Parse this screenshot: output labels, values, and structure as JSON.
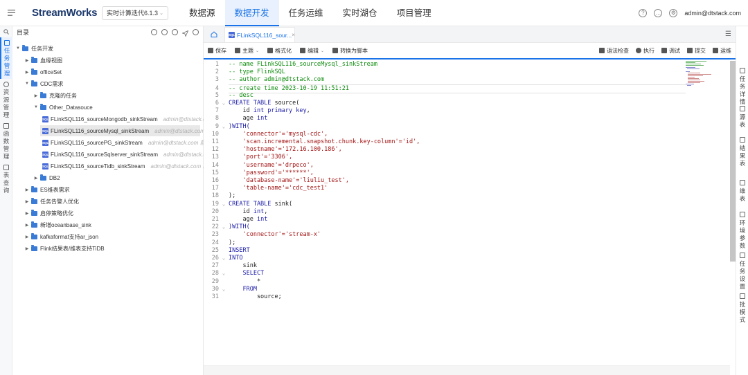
{
  "header": {
    "logo_text": "StreamWorks",
    "project_select": "实时计算迭代6.1.3",
    "nav": [
      "数据源",
      "数据开发",
      "任务运维",
      "实时湖仓",
      "项目管理"
    ],
    "active_nav": "数据开发",
    "user": "admin@dtstack.com"
  },
  "leftnav": {
    "items": [
      {
        "label": "任务管理",
        "active": true
      },
      {
        "label": "资源管理",
        "active": false
      },
      {
        "label": "函数管理",
        "active": false
      },
      {
        "label": "表查询",
        "active": false
      }
    ]
  },
  "tree": {
    "title": "目录",
    "nodes": [
      {
        "label": "任务开发",
        "type": "folder",
        "depth": 0,
        "expanded": true
      },
      {
        "label": "血缘视图",
        "type": "folder",
        "depth": 1,
        "expanded": false
      },
      {
        "label": "officeSet",
        "type": "folder",
        "depth": 1,
        "expanded": false
      },
      {
        "label": "CDC需求",
        "type": "folder",
        "depth": 1,
        "expanded": true
      },
      {
        "label": "克隆的任务",
        "type": "folder",
        "depth": 2,
        "expanded": false
      },
      {
        "label": "Other_Datasouce",
        "type": "folder",
        "depth": 2,
        "expanded": true
      },
      {
        "label": "FLinkSQL116_sourceMongodb_sinkStream",
        "type": "sql",
        "depth": 3,
        "owner": "admin@dtstack.c..."
      },
      {
        "label": "FLinkSQL116_sourceMysql_sinkStream",
        "type": "sql",
        "depth": 3,
        "owner": "admin@dtstack.com",
        "selected": true
      },
      {
        "label": "FLinkSQL116_sourcePG_sinkStream",
        "type": "sql",
        "depth": 3,
        "owner": "admin@dtstack.com 就..."
      },
      {
        "label": "FLinkSQL116_sourceSqlserver_sinkStream",
        "type": "sql",
        "depth": 3,
        "owner": "admin@dtstack.c..."
      },
      {
        "label": "FLinkSQL116_sourceTidb_sinkStream",
        "type": "sql",
        "depth": 3,
        "owner": "admin@dtstack.com 就..."
      },
      {
        "label": "DB2",
        "type": "folder",
        "depth": 2,
        "expanded": false
      },
      {
        "label": "ES维表需求",
        "type": "folder",
        "depth": 1,
        "expanded": false
      },
      {
        "label": "任务告警人优化",
        "type": "folder",
        "depth": 1,
        "expanded": false
      },
      {
        "label": "启停策略优化",
        "type": "folder",
        "depth": 1,
        "expanded": false
      },
      {
        "label": "新增oceanbase_sink",
        "type": "folder",
        "depth": 1,
        "expanded": false
      },
      {
        "label": "kafkaformat支持ar_json",
        "type": "folder",
        "depth": 1,
        "expanded": false
      },
      {
        "label": "Flink结果表/维表支持TiDB",
        "type": "folder",
        "depth": 1,
        "expanded": false
      }
    ]
  },
  "editor": {
    "tab_label": "FLinkSQL116_sour...",
    "toolbar_left": [
      {
        "label": "保存",
        "dropdown": false
      },
      {
        "label": "主题",
        "dropdown": true
      },
      {
        "label": "格式化",
        "dropdown": false
      },
      {
        "label": "编辑",
        "dropdown": true
      },
      {
        "label": "转换为脚本",
        "dropdown": false
      }
    ],
    "toolbar_right": [
      "语法检查",
      "执行",
      "调试",
      "提交",
      "运维"
    ],
    "code_lines": [
      {
        "n": "1",
        "fold": "",
        "parts": [
          {
            "t": "-- name FLinkSQL116_sourceMysql_sinkStream",
            "c": "com"
          }
        ]
      },
      {
        "n": "2",
        "fold": "",
        "parts": [
          {
            "t": "-- type FlinkSQL",
            "c": "com"
          }
        ]
      },
      {
        "n": "3",
        "fold": "",
        "parts": [
          {
            "t": "-- author admin@dtstack.com",
            "c": "com"
          }
        ]
      },
      {
        "n": "4",
        "fold": "",
        "hl": true,
        "parts": [
          {
            "t": "-- create time 2023-10-19 11:51:21",
            "c": "com"
          }
        ]
      },
      {
        "n": "5",
        "fold": "",
        "parts": [
          {
            "t": "-- desc",
            "c": "com"
          }
        ]
      },
      {
        "n": "6",
        "fold": "v",
        "parts": [
          {
            "t": "CREATE TABLE ",
            "c": "kw"
          },
          {
            "t": "source(",
            "c": "id"
          }
        ]
      },
      {
        "n": "7",
        "fold": "",
        "parts": [
          {
            "t": "    id ",
            "c": "id"
          },
          {
            "t": "int primary key",
            "c": "kw"
          },
          {
            "t": ",",
            "c": "id"
          }
        ]
      },
      {
        "n": "8",
        "fold": "",
        "parts": [
          {
            "t": "    age ",
            "c": "id"
          },
          {
            "t": "int",
            "c": "kw"
          }
        ]
      },
      {
        "n": "9",
        "fold": "v",
        "parts": [
          {
            "t": ")WITH(",
            "c": "kw"
          }
        ]
      },
      {
        "n": "10",
        "fold": "",
        "parts": [
          {
            "t": "    'connector'='mysql-cdc',",
            "c": "str"
          }
        ]
      },
      {
        "n": "11",
        "fold": "",
        "parts": [
          {
            "t": "    'scan.incremental.snapshot.chunk.key-column'='id',",
            "c": "str"
          }
        ]
      },
      {
        "n": "12",
        "fold": "",
        "parts": [
          {
            "t": "    'hostname'='172.16.100.186',",
            "c": "str"
          }
        ]
      },
      {
        "n": "13",
        "fold": "",
        "parts": [
          {
            "t": "    'port'='3306',",
            "c": "str"
          }
        ]
      },
      {
        "n": "14",
        "fold": "",
        "parts": [
          {
            "t": "    'username'='drpeco',",
            "c": "str"
          }
        ]
      },
      {
        "n": "15",
        "fold": "",
        "parts": [
          {
            "t": "    'password'='******',",
            "c": "str"
          }
        ]
      },
      {
        "n": "16",
        "fold": "",
        "parts": [
          {
            "t": "    'database-name'='liuliu_test',",
            "c": "str"
          }
        ]
      },
      {
        "n": "17",
        "fold": "",
        "parts": [
          {
            "t": "    'table-name'='cdc_test1'",
            "c": "str"
          }
        ]
      },
      {
        "n": "18",
        "fold": "",
        "parts": [
          {
            "t": ");",
            "c": "id"
          }
        ]
      },
      {
        "n": "19",
        "fold": "v",
        "parts": [
          {
            "t": "CREATE TABLE ",
            "c": "kw"
          },
          {
            "t": "sink(",
            "c": "id"
          }
        ]
      },
      {
        "n": "20",
        "fold": "",
        "parts": [
          {
            "t": "    id ",
            "c": "id"
          },
          {
            "t": "int",
            "c": "kw"
          },
          {
            "t": ",",
            "c": "id"
          }
        ]
      },
      {
        "n": "21",
        "fold": "",
        "parts": [
          {
            "t": "    age ",
            "c": "id"
          },
          {
            "t": "int",
            "c": "kw"
          }
        ]
      },
      {
        "n": "22",
        "fold": "v",
        "parts": [
          {
            "t": ")WITH(",
            "c": "kw"
          }
        ]
      },
      {
        "n": "23",
        "fold": "",
        "parts": [
          {
            "t": "    'connector'='stream-x'",
            "c": "str"
          }
        ]
      },
      {
        "n": "24",
        "fold": "",
        "parts": [
          {
            "t": ");",
            "c": "id"
          }
        ]
      },
      {
        "n": "25",
        "fold": "",
        "parts": [
          {
            "t": "INSERT",
            "c": "kw"
          }
        ]
      },
      {
        "n": "26",
        "fold": "v",
        "parts": [
          {
            "t": "INTO",
            "c": "kw"
          }
        ]
      },
      {
        "n": "27",
        "fold": "",
        "parts": [
          {
            "t": "    sink",
            "c": "id"
          }
        ]
      },
      {
        "n": "28",
        "fold": "v",
        "parts": [
          {
            "t": "    SELECT",
            "c": "kw"
          }
        ]
      },
      {
        "n": "29",
        "fold": "",
        "parts": [
          {
            "t": "        *",
            "c": "id"
          }
        ]
      },
      {
        "n": "30",
        "fold": "v",
        "parts": [
          {
            "t": "    FROM",
            "c": "kw"
          }
        ]
      },
      {
        "n": "31",
        "fold": "",
        "parts": [
          {
            "t": "        source;",
            "c": "id"
          }
        ]
      }
    ]
  },
  "rightrail": {
    "items": [
      "任务详情",
      "源表",
      "结果表",
      "维表",
      "环境参数",
      "任务设置",
      "批模式"
    ]
  },
  "colors": {
    "accent": "#1a73e8",
    "comment": "#0b8a0b",
    "keyword": "#1a1aa6",
    "string": "#a31515",
    "folder": "#3a7bd5"
  }
}
